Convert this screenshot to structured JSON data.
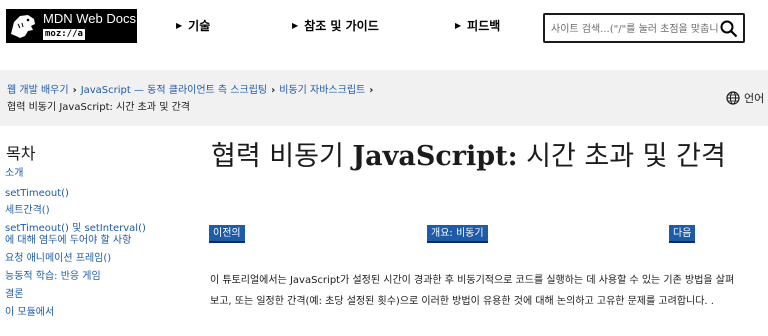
{
  "header": {
    "logo_text": "MDN Web Docs",
    "logo_sub": "moz://a",
    "nav": [
      {
        "label": "기술"
      },
      {
        "label": "참조 및 가이드"
      },
      {
        "label": "피드백"
      }
    ],
    "search_placeholder": "사이트 검색...(\"/\"를 눌러 초점을 맞춥니다)"
  },
  "breadcrumb": {
    "items": [
      "웹 개발 배우기",
      "JavaScript — 동적 클라이언트 측 스크립팅",
      "비동기 자바스크립트"
    ],
    "current": "협력 비동기 JavaScript: 시간 초과 및 간격"
  },
  "language_label": "언어",
  "toc": {
    "title": "목차",
    "items": [
      "소개",
      "setTimeout()",
      "세트간격()",
      "setTimeout() 및 setInterval()에 대해 염두에 두어야 할 사항",
      "요청 애니메이션 프레임()",
      "능동적 학습: 반응 게임",
      "결론",
      "이 모듈에서"
    ]
  },
  "main": {
    "title_part1": "협력 비동기 ",
    "title_part2": "JavaScript:",
    "title_part3": " 시간 초과 및 간격",
    "seq_prev": "이전의",
    "seq_overview": "개요: 비동기",
    "seq_next": "다음",
    "intro": "이 튜토리얼에서는 JavaScript가 설정된 시간이 경과한 후 비동기적으로 코드를 실행하는 데 사용할 수 있는 기존 방법을 살펴보고, 또는 일정한 간격(예: 초당 설정된 횟수)으로 이러한 방법이 유용한 것에 대해 논의하고 고유한 문제를 고려합니다. ."
  },
  "colors": {
    "link": "#1e5ba8",
    "button_bg": "#1e5ba8",
    "crumb_bar": "#f2f1f1",
    "text": "#1b1b1b"
  }
}
